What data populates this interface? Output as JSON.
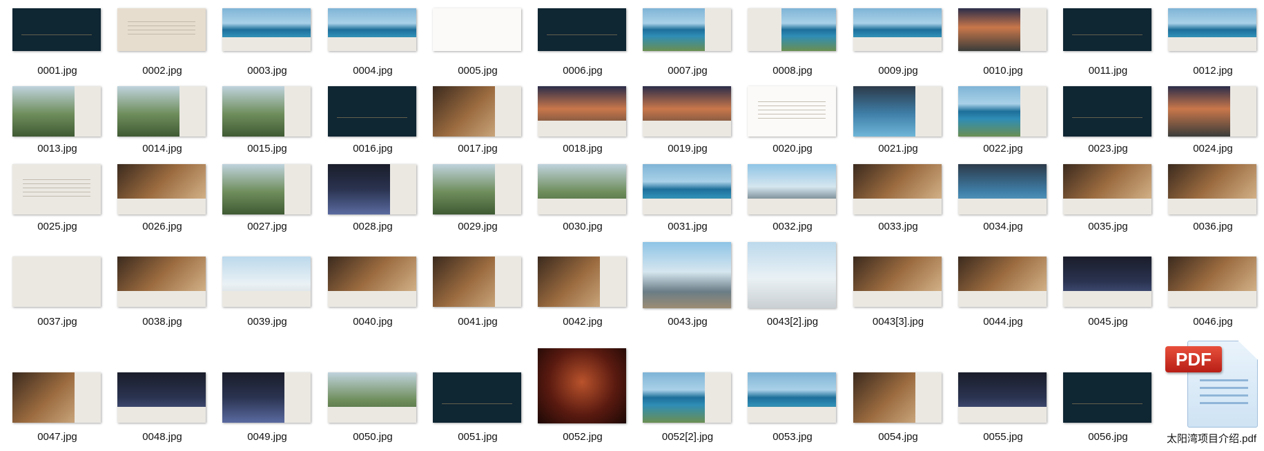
{
  "window": {
    "title": ""
  },
  "files": [
    {
      "name": "0001.jpg",
      "style": "navy"
    },
    {
      "name": "0002.jpg",
      "style": "beige lines"
    },
    {
      "name": "0003.jpg",
      "style": "photo-sea split-b"
    },
    {
      "name": "0004.jpg",
      "style": "photo-sea split-b"
    },
    {
      "name": "0005.jpg",
      "style": "white"
    },
    {
      "name": "0006.jpg",
      "style": "navy"
    },
    {
      "name": "0007.jpg",
      "style": "photo-sea split-r"
    },
    {
      "name": "0008.jpg",
      "style": "photo-sea split-l"
    },
    {
      "name": "0009.jpg",
      "style": "photo-sea split-b"
    },
    {
      "name": "0010.jpg",
      "style": "photo-dusk split-r"
    },
    {
      "name": "0011.jpg",
      "style": "navy"
    },
    {
      "name": "0012.jpg",
      "style": "photo-sea split-b"
    },
    {
      "name": "0013.jpg",
      "style": "photo-green split-r"
    },
    {
      "name": "0014.jpg",
      "style": "photo-green split-r"
    },
    {
      "name": "0015.jpg",
      "style": "photo-green split-r"
    },
    {
      "name": "0016.jpg",
      "style": "navy"
    },
    {
      "name": "0017.jpg",
      "style": "photo-warm split-r"
    },
    {
      "name": "0018.jpg",
      "style": "photo-dusk split-b"
    },
    {
      "name": "0019.jpg",
      "style": "photo-dusk split-b"
    },
    {
      "name": "0020.jpg",
      "style": "white lines"
    },
    {
      "name": "0021.jpg",
      "style": "photo-pool split-r"
    },
    {
      "name": "0022.jpg",
      "style": "photo-sea split-r"
    },
    {
      "name": "0023.jpg",
      "style": "navy"
    },
    {
      "name": "0024.jpg",
      "style": "photo-dusk split-r"
    },
    {
      "name": "0025.jpg",
      "style": "cream lines"
    },
    {
      "name": "0026.jpg",
      "style": "photo-warm split-b"
    },
    {
      "name": "0027.jpg",
      "style": "photo-green split-r"
    },
    {
      "name": "0028.jpg",
      "style": "photo-night split-r"
    },
    {
      "name": "0029.jpg",
      "style": "photo-green split-r"
    },
    {
      "name": "0030.jpg",
      "style": "photo-green split-b"
    },
    {
      "name": "0031.jpg",
      "style": "photo-sea split-b"
    },
    {
      "name": "0032.jpg",
      "style": "photo-sky split-b"
    },
    {
      "name": "0033.jpg",
      "style": "photo-warm split-b"
    },
    {
      "name": "0034.jpg",
      "style": "photo-pool split-b"
    },
    {
      "name": "0035.jpg",
      "style": "photo-warm split-b"
    },
    {
      "name": "0036.jpg",
      "style": "photo-warm split-b"
    },
    {
      "name": "0037.jpg",
      "style": "cream"
    },
    {
      "name": "0038.jpg",
      "style": "photo-warm split-b"
    },
    {
      "name": "0039.jpg",
      "style": "photo-boat split-b"
    },
    {
      "name": "0040.jpg",
      "style": "photo-warm split-b"
    },
    {
      "name": "0041.jpg",
      "style": "photo-warm split-r"
    },
    {
      "name": "0042.jpg",
      "style": "photo-warm split-r"
    },
    {
      "name": "0043.jpg",
      "style": "photo-sky"
    },
    {
      "name": "0043[2].jpg",
      "style": "photo-boat"
    },
    {
      "name": "0043[3].jpg",
      "style": "photo-warm split-b"
    },
    {
      "name": "0044.jpg",
      "style": "photo-warm split-b"
    },
    {
      "name": "0045.jpg",
      "style": "photo-night split-b"
    },
    {
      "name": "0046.jpg",
      "style": "photo-warm split-b"
    },
    {
      "name": "0047.jpg",
      "style": "photo-warm split-r"
    },
    {
      "name": "0048.jpg",
      "style": "photo-night split-b"
    },
    {
      "name": "0049.jpg",
      "style": "photo-night split-r"
    },
    {
      "name": "0050.jpg",
      "style": "photo-green split-b"
    },
    {
      "name": "0051.jpg",
      "style": "navy"
    },
    {
      "name": "0052.jpg",
      "style": "photo-red"
    },
    {
      "name": "0052[2].jpg",
      "style": "photo-sea split-r"
    },
    {
      "name": "0053.jpg",
      "style": "photo-sea split-b"
    },
    {
      "name": "0054.jpg",
      "style": "photo-warm split-r"
    },
    {
      "name": "0055.jpg",
      "style": "photo-night split-b"
    },
    {
      "name": "0056.jpg",
      "style": "navy"
    }
  ],
  "pdf": {
    "name": "太阳湾项目介绍.pdf",
    "badge": "PDF"
  }
}
